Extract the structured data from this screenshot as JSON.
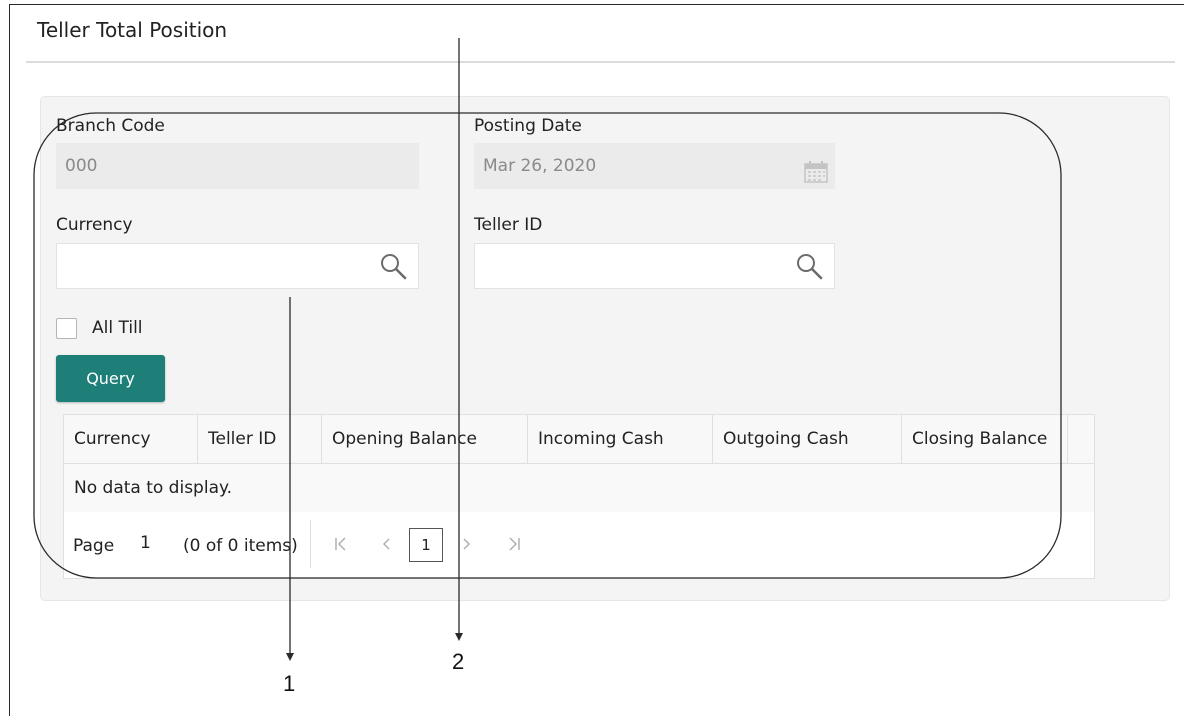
{
  "page": {
    "title": "Teller Total Position"
  },
  "form": {
    "branch_code": {
      "label": "Branch Code",
      "value": "000"
    },
    "posting_date": {
      "label": "Posting Date",
      "value": "Mar 26, 2020",
      "icon": "calendar-icon"
    },
    "currency": {
      "label": "Currency",
      "value": "",
      "icon": "search-icon"
    },
    "teller_id": {
      "label": "Teller ID",
      "value": "",
      "icon": "search-icon"
    },
    "all_till": {
      "label": "All Till",
      "checked": false
    },
    "query_label": "Query"
  },
  "table": {
    "columns": [
      "Currency",
      "Teller ID",
      "Opening Balance",
      "Incoming Cash",
      "Outgoing Cash",
      "Closing Balance"
    ],
    "empty_message": "No data to display."
  },
  "pager": {
    "page_label": "Page",
    "page_number": "1",
    "items_info": "(0 of 0 items)",
    "current_page": "1",
    "icons": [
      "first-page-icon",
      "prev-page-icon",
      "next-page-icon",
      "last-page-icon"
    ]
  },
  "callouts": {
    "one": "1",
    "two": "2"
  },
  "colors": {
    "accent": "#1d7f77",
    "panel_bg": "#f4f4f4",
    "readonly_bg": "#ebebeb"
  }
}
